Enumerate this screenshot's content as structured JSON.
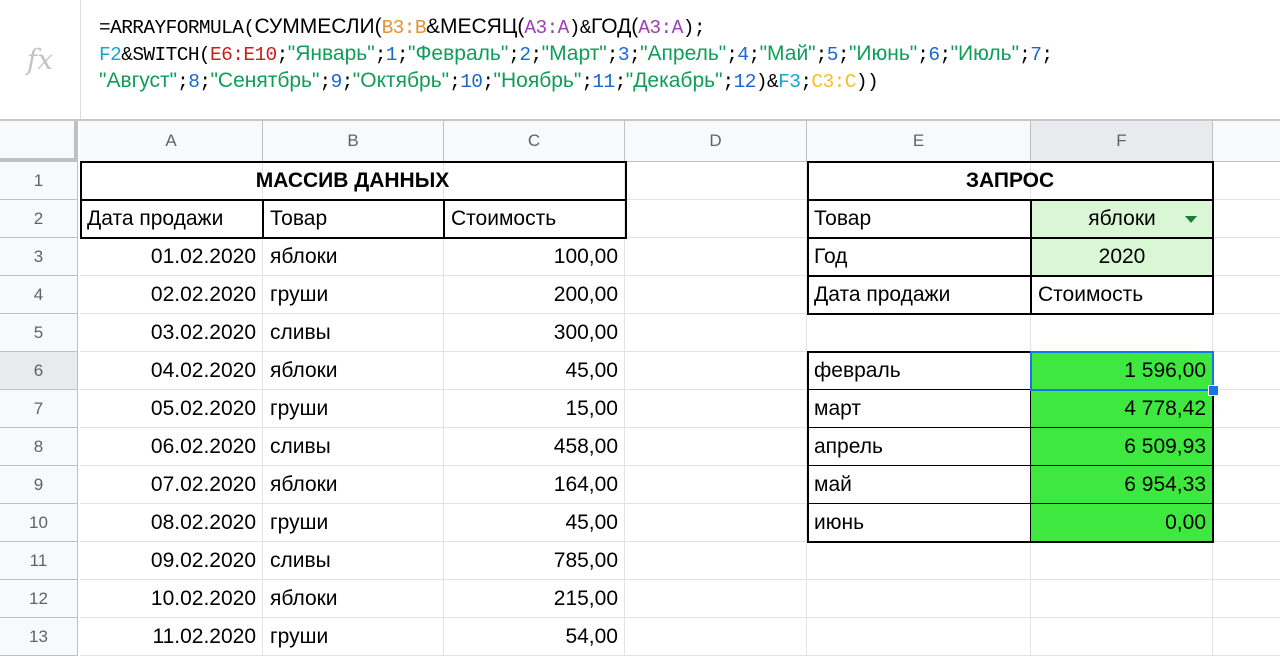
{
  "formula_bar": {
    "fx_label": "fx",
    "line1": {
      "p1": "=ARRAYFORMULA(",
      "p2": "СУММЕСЛИ(",
      "ref1": "B3:B",
      "p3": "&",
      "p4": "МЕСЯЦ(",
      "ref2": "A3:A",
      "p5": ")&",
      "p6": "ГОД(",
      "ref3": "A3:A",
      "p7": ");"
    },
    "line2": {
      "ref_f2": "F2",
      "p1": "&SWITCH(",
      "ref_e": "E6:E10",
      "p2": ";",
      "m1": "\"Январь\"",
      "sep1": ";",
      "n1": "1",
      "sep1b": ";",
      "m2": "\"Февраль\"",
      "sep2": ";",
      "n2": "2",
      "sep2b": ";",
      "m3": "\"Март\"",
      "sep3": ";",
      "n3": "3",
      "sep3b": ";",
      "m4": "\"Апрель\"",
      "sep4": ";",
      "n4": "4",
      "sep4b": ";",
      "m5": "\"Май\"",
      "sep5": ";",
      "n5": "5",
      "sep5b": ";",
      "m6": "\"Июнь\"",
      "sep6": ";",
      "n6": "6",
      "sep6b": ";",
      "m7": "\"Июль\"",
      "sep7": ";",
      "n7": "7",
      "sep7b": ";"
    },
    "line3": {
      "m8": "\"Август\"",
      "sep8": ";",
      "n8": "8",
      "sep8b": ";",
      "m9": "\"Сенятбрь\"",
      "sep9": ";",
      "n9": "9",
      "sep9b": ";",
      "m10": "\"Октябрь\"",
      "sep10": ";",
      "n10": "10",
      "sep10b": ";",
      "m11": "\"Ноябрь\"",
      "sep11": ";",
      "n11": "11",
      "sep11b": ";",
      "m12": "\"Декабрь\"",
      "sep12": ";",
      "n12": "12",
      "p1": ")&",
      "ref_f3": "F3",
      "p2": ";",
      "ref_c": "C3:C",
      "p3": "))"
    }
  },
  "columns": [
    "A",
    "B",
    "C",
    "D",
    "E",
    "F"
  ],
  "rows": [
    "1",
    "2",
    "3",
    "4",
    "5",
    "6",
    "7",
    "8",
    "9",
    "10",
    "11",
    "12",
    "13"
  ],
  "data_table": {
    "title": "МАССИВ ДАННЫХ",
    "headers": [
      "Дата продажи",
      "Товар",
      "Стоимость"
    ],
    "rows": [
      [
        "01.02.2020",
        "яблоки",
        "100,00"
      ],
      [
        "02.02.2020",
        "груши",
        "200,00"
      ],
      [
        "03.02.2020",
        "сливы",
        "300,00"
      ],
      [
        "04.02.2020",
        "яблоки",
        "45,00"
      ],
      [
        "05.02.2020",
        "груши",
        "15,00"
      ],
      [
        "06.02.2020",
        "сливы",
        "458,00"
      ],
      [
        "07.02.2020",
        "яблоки",
        "164,00"
      ],
      [
        "08.02.2020",
        "груши",
        "45,00"
      ],
      [
        "09.02.2020",
        "сливы",
        "785,00"
      ],
      [
        "10.02.2020",
        "яблоки",
        "215,00"
      ],
      [
        "11.02.2020",
        "груши",
        "54,00"
      ]
    ]
  },
  "query": {
    "title": "ЗАПРОС",
    "product_label": "Товар",
    "product_value": "яблоки",
    "year_label": "Год",
    "year_value": "2020",
    "date_header": "Дата продажи",
    "cost_header": "Стоимость",
    "results": [
      [
        "февраль",
        "1 596,00"
      ],
      [
        "март",
        "4 778,42"
      ],
      [
        "апрель",
        "6 509,93"
      ],
      [
        "май",
        "6 954,33"
      ],
      [
        "июнь",
        "0,00"
      ]
    ]
  },
  "colors": {
    "light_green": "#d9f6d5",
    "bright_green": "#3ee83e",
    "selection_blue": "#1a73e8",
    "dropdown_arrow": "#188038"
  },
  "icons": [
    "fx-icon",
    "dropdown-arrow-icon",
    "fill-handle-icon"
  ]
}
